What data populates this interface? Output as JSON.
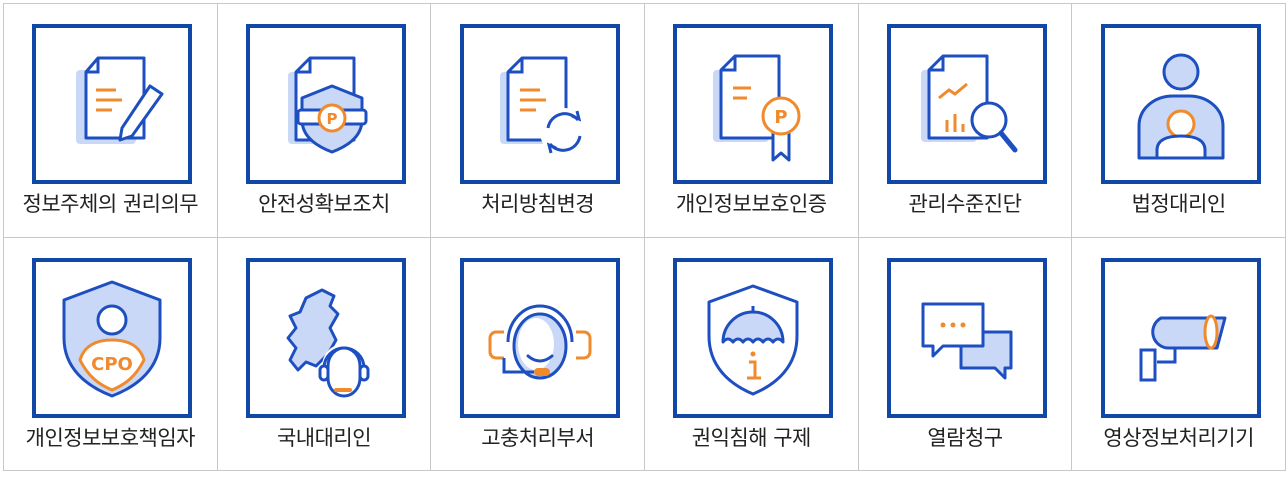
{
  "colors": {
    "frame": "#1148a8",
    "line": "#1d4fc0",
    "fill": "#c9d8f7",
    "accent": "#f08a2c"
  },
  "items": [
    {
      "label": "정보주체의 권리의무",
      "icon": "document-pen-icon"
    },
    {
      "label": "안전성확보조치",
      "icon": "document-shield-icon"
    },
    {
      "label": "처리방침변경",
      "icon": "document-refresh-icon"
    },
    {
      "label": "개인정보보호인증",
      "icon": "document-certificate-icon"
    },
    {
      "label": "관리수준진단",
      "icon": "report-magnifier-icon"
    },
    {
      "label": "법정대리인",
      "icon": "guardian-user-icon"
    },
    {
      "label": "개인정보보호책임자",
      "icon": "cpo-shield-icon"
    },
    {
      "label": "국내대리인",
      "icon": "korea-map-headset-icon"
    },
    {
      "label": "고충처리부서",
      "icon": "headset-agent-icon"
    },
    {
      "label": "권익침해 구제",
      "icon": "shield-umbrella-icon"
    },
    {
      "label": "열람청구",
      "icon": "chat-bubbles-icon"
    },
    {
      "label": "영상정보처리기기",
      "icon": "cctv-camera-icon"
    }
  ]
}
